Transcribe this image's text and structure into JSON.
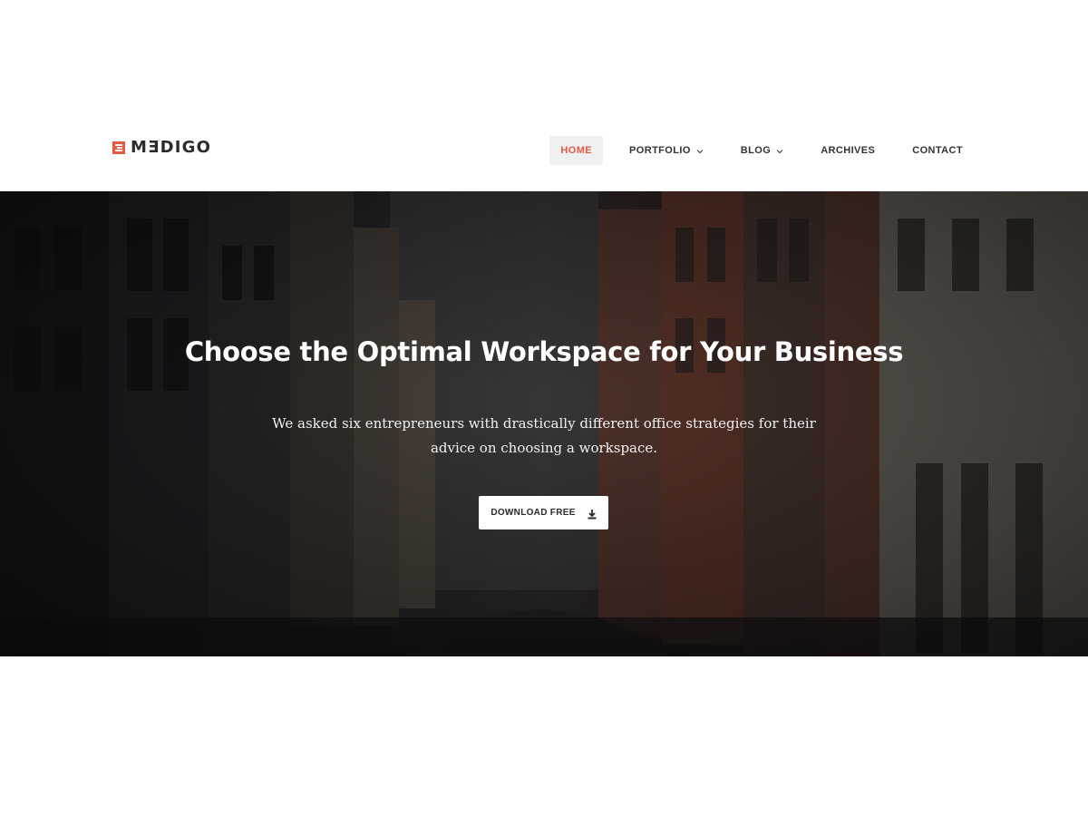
{
  "brand": {
    "name": "MƎDIGO",
    "accent_color": "#e85a42",
    "logo_icon": "medigo-logo-icon"
  },
  "nav": {
    "items": [
      {
        "label": "HOME",
        "active": true,
        "has_dropdown": false
      },
      {
        "label": "PORTFOLIO",
        "active": false,
        "has_dropdown": true,
        "icon": "chevron-down-icon"
      },
      {
        "label": "BLOG",
        "active": false,
        "has_dropdown": true,
        "icon": "chevron-down-icon"
      },
      {
        "label": "ARCHIVES",
        "active": false,
        "has_dropdown": false
      },
      {
        "label": "CONTACT",
        "active": false,
        "has_dropdown": false
      }
    ]
  },
  "hero": {
    "title": "Choose the Optimal Workspace for Your Business",
    "subtitle": "We asked six entrepreneurs with drastically different office strategies for their advice on choosing a workspace.",
    "button_label": "DOWNLOAD FREE",
    "button_icon": "download-icon",
    "background": "city-street-photo"
  }
}
